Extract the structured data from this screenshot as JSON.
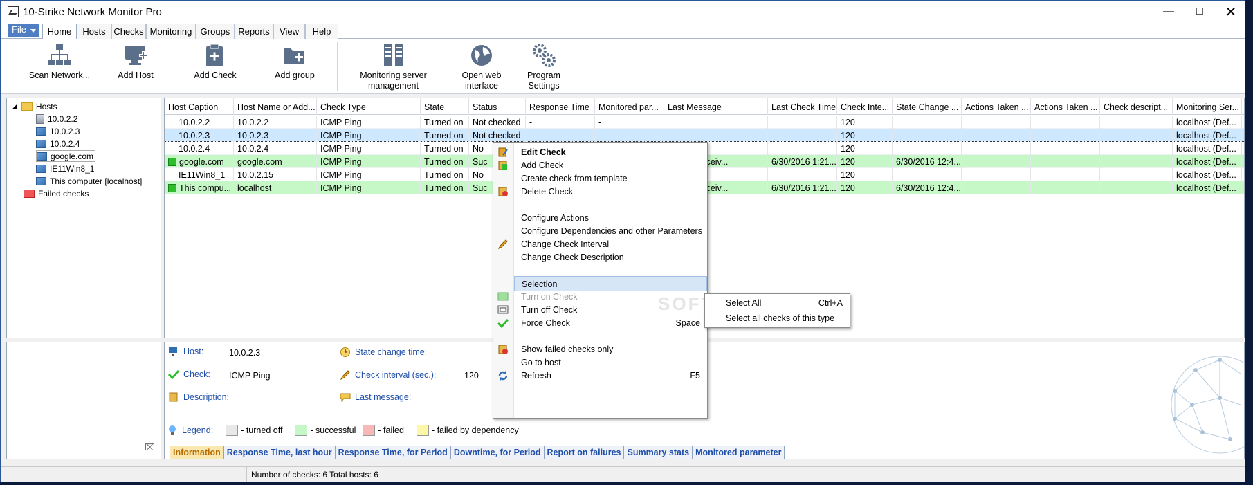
{
  "window": {
    "title": "10-Strike Network Monitor Pro"
  },
  "ribbon_tabs": {
    "file": "File",
    "items": [
      "Home",
      "Hosts",
      "Checks",
      "Monitoring",
      "Groups",
      "Reports",
      "View",
      "Help"
    ]
  },
  "toolbar": {
    "scan": [
      "Scan Network..."
    ],
    "add_host": [
      "Add Host"
    ],
    "add_check": [
      "Add Check"
    ],
    "add_group": [
      "Add group"
    ],
    "server_mgmt": [
      "Monitoring server",
      "management"
    ],
    "web": [
      "Open web",
      "interface"
    ],
    "settings": [
      "Program",
      "Settings"
    ]
  },
  "tree": {
    "root": "Hosts",
    "hosts": [
      "10.0.2.2",
      "10.0.2.3",
      "10.0.2.4",
      "google.com",
      "IE11Win8_1",
      "This computer [localhost]"
    ],
    "failed": "Failed checks"
  },
  "grid": {
    "columns": [
      "Host Caption",
      "Host Name or Add...",
      "Check Type",
      "State",
      "Status",
      "Response Time",
      "Monitored par...",
      "Last Message",
      "Last Check Time",
      "Check Inte...",
      "State Change ...",
      "Actions Taken ...",
      "Actions Taken ...",
      "Check descript...",
      "Monitoring Ser..."
    ],
    "rows": [
      {
        "status": "off",
        "cells": [
          "10.0.2.2",
          "10.0.2.2",
          "ICMP Ping",
          "Turned on",
          "Not checked",
          "-",
          "-",
          "",
          "",
          "120",
          "",
          "",
          "",
          "",
          "localhost (Def..."
        ]
      },
      {
        "status": "sel",
        "cells": [
          "10.0.2.3",
          "10.0.2.3",
          "ICMP Ping",
          "Turned on",
          "Not checked",
          "-",
          "-",
          "",
          "",
          "120",
          "",
          "",
          "",
          "",
          "localhost (Def..."
        ]
      },
      {
        "status": "off",
        "cells": [
          "10.0.2.4",
          "10.0.2.4",
          "ICMP Ping",
          "Turned on",
          "No",
          "",
          "",
          "",
          "",
          "120",
          "",
          "",
          "",
          "",
          "localhost (Def..."
        ]
      },
      {
        "status": "ok",
        "cells": [
          "google.com",
          "google.com",
          "ICMP Ping",
          "Turned on",
          "Suc",
          "",
          "",
          "g: reply receiv...",
          "6/30/2016 1:21...",
          "120",
          "6/30/2016 12:4...",
          "",
          "",
          "",
          "localhost (Def..."
        ]
      },
      {
        "status": "off",
        "cells": [
          "IE11Win8_1",
          "10.0.2.15",
          "ICMP Ping",
          "Turned on",
          "No",
          "",
          "",
          "",
          "",
          "120",
          "",
          "",
          "",
          "",
          "localhost (Def..."
        ]
      },
      {
        "status": "ok",
        "cells": [
          "This compu...",
          "localhost",
          "ICMP Ping",
          "Turned on",
          "Suc",
          "",
          "",
          "g: reply receiv...",
          "6/30/2016 1:21...",
          "120",
          "6/30/2016 12:4...",
          "",
          "",
          "",
          "localhost (Def..."
        ]
      }
    ]
  },
  "context_menu": {
    "items": [
      {
        "label": "Edit Check",
        "bold": true,
        "icon": "edit-icon"
      },
      {
        "label": "Add Check",
        "icon": "add-check-icon"
      },
      {
        "label": "Create check from template"
      },
      {
        "label": "Delete Check",
        "icon": "delete-icon"
      },
      {
        "label": "Configure Actions"
      },
      {
        "label": "Configure Dependencies and other Parameters"
      },
      {
        "label": "Change Check Interval",
        "icon": "pencil-icon"
      },
      {
        "label": "Change Check Description"
      },
      {
        "label": "Selection",
        "highlight": true
      },
      {
        "label": "Turn on Check",
        "disabled": true,
        "icon": "turn-on-icon"
      },
      {
        "label": "Turn off Check",
        "icon": "turn-off-icon"
      },
      {
        "label": "Force Check",
        "shortcut": "Space",
        "icon": "checkmark-icon"
      },
      {
        "label": "Show failed checks only",
        "icon": "filter-icon"
      },
      {
        "label": "Go to host"
      },
      {
        "label": "Refresh",
        "shortcut": "F5",
        "icon": "refresh-icon"
      }
    ]
  },
  "submenu": {
    "items": [
      {
        "label": "Select All",
        "shortcut": "Ctrl+A"
      },
      {
        "label": "Select all checks of this type",
        "shortcut": ""
      }
    ]
  },
  "watermark": "SOFT",
  "info": {
    "host_label": "Host:",
    "host_value": "10.0.2.3",
    "check_label": "Check:",
    "check_value": "ICMP Ping",
    "desc_label": "Description:",
    "state_change_label": "State change time:",
    "interval_label": "Check interval (sec.):",
    "interval_value": "120",
    "last_msg_label": "Last message:",
    "legend_label": "Legend:",
    "legend": [
      {
        "text": "- turned off",
        "color": "#e8e8e8"
      },
      {
        "text": "- successful",
        "color": "#c6f7c6"
      },
      {
        "text": "- failed",
        "color": "#f8b8b8"
      },
      {
        "text": "- failed by dependency",
        "color": "#fdf7a8"
      }
    ]
  },
  "bottom_tabs": [
    "Information",
    "Response Time, last hour",
    "Response Time, for Period",
    "Downtime, for Period",
    "Report on failures",
    "Summary stats",
    "Monitored parameter"
  ],
  "status": {
    "text": "Number of checks: 6  Total hosts: 6"
  },
  "colors": {
    "accent": "#4f7ec2",
    "link": "#1f4fa8",
    "success": "#c6f7c6",
    "selected": "#cde8ff"
  }
}
